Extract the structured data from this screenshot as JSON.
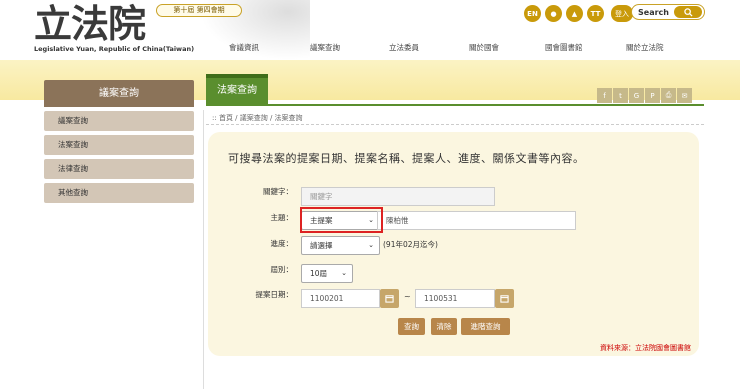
{
  "header": {
    "logo_text": "立法院",
    "logo_en": "Legislative Yuan, Republic of China(Taiwan)",
    "session": "第十屆 第四會期",
    "lang_en": "EN",
    "login": "登入",
    "search_label": "Search",
    "nav": [
      "會議資訊",
      "議案查詢",
      "立法委員",
      "關於國會",
      "國會圖書館",
      "關於立法院"
    ]
  },
  "sidebar": {
    "title": "議案查詢",
    "items": [
      {
        "label": "議案查詢"
      },
      {
        "label": "法案查詢"
      },
      {
        "label": "法律查詢"
      },
      {
        "label": "其他查詢"
      }
    ]
  },
  "main": {
    "tab": "法案查詢",
    "breadcrumb": ":: 首頁 / 議案查詢 / 法案查詢",
    "panel_title": "可搜尋法案的提案日期、提案名稱、提案人、進度、關係文書等內容。",
    "form": {
      "keyword_label": "關鍵字：",
      "keyword_placeholder": "關鍵字",
      "subject_label": "主題：",
      "subject_select": "主提案",
      "subject_value": "陳柏惟",
      "progress_label": "進度：",
      "progress_select": "請選擇",
      "progress_note": "(91年02月迄今)",
      "term_label": "屆別：",
      "term_select": "10屆",
      "date_label": "提案日期：",
      "date_from": "1100201",
      "date_sep": "~",
      "date_to": "1100531"
    },
    "buttons": {
      "query": "查詢",
      "clear": "清除",
      "advanced": "進階查詢"
    },
    "source": "資料來源：立法院國會圖書館"
  },
  "colors": {
    "accent_green": "#5a8e2e",
    "gold": "#c99a0a",
    "sidebar_brown": "#8b7359",
    "button": "#b8864a"
  }
}
